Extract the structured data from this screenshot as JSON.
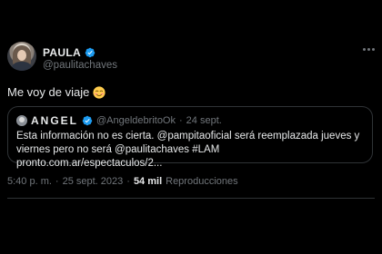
{
  "author": {
    "name": "PAULA",
    "handle": "@paulitachaves",
    "verified": true,
    "avatar_icon": "profile-photo"
  },
  "tweet": {
    "text": "Me voy de viaje",
    "emoji": "smiling-face-emoji"
  },
  "quote": {
    "name": "ANGEL",
    "handle": "@AngeldebritoOk",
    "separator": "·",
    "date": "24 sept.",
    "verified": true,
    "text_line1": "Esta información no es cierta. @pampitaoficial será reemplazada jueves y",
    "text_line2": "viernes pero no será @paulitachaves #LAM pronto.com.ar/espectaculos/2..."
  },
  "meta": {
    "time": "5:40 p. m.",
    "separator1": "·",
    "date": "25 sept. 2023",
    "separator2": "·",
    "views_count": "54 mil",
    "views_label": "Reproducciones"
  },
  "colors": {
    "background": "#000000",
    "text": "#e7e9ea",
    "secondary": "#71767b",
    "verified_blue": "#1d9bf0",
    "border": "#2f3336"
  }
}
